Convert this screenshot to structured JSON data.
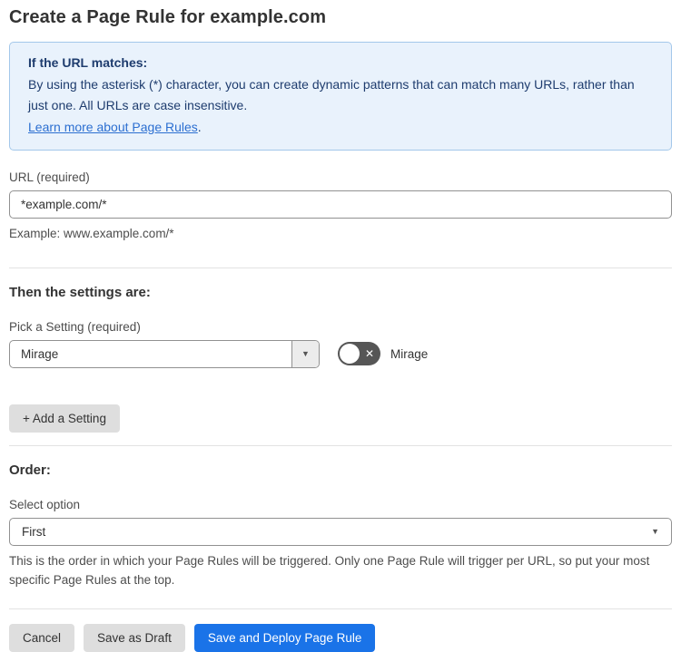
{
  "page": {
    "title": "Create a Page Rule for example.com"
  },
  "info_box": {
    "heading": "If the URL matches:",
    "body": "By using the asterisk (*) character, you can create dynamic patterns that can match many URLs, rather than just one. All URLs are case insensitive.",
    "link_label": "Learn more about Page Rules",
    "link_suffix": "."
  },
  "url_field": {
    "label": "URL (required)",
    "value": "*example.com/*",
    "helper": "Example: www.example.com/*"
  },
  "settings_section": {
    "heading": "Then the settings are:",
    "picker_label": "Pick a Setting (required)",
    "picker_value": "Mirage",
    "toggle_label": "Mirage",
    "toggle_state": "off",
    "add_button_label": "+ Add a Setting"
  },
  "order_section": {
    "heading": "Order:",
    "select_label": "Select option",
    "select_value": "First",
    "helper": "This is the order in which your Page Rules will be triggered. Only one Page Rule will trigger per URL, so put your most specific Page Rules at the top."
  },
  "footer": {
    "cancel_label": "Cancel",
    "save_draft_label": "Save as Draft",
    "save_deploy_label": "Save and Deploy Page Rule"
  },
  "icons": {
    "dropdown_arrow": "▼",
    "toggle_x": "✕"
  },
  "colors": {
    "accent_blue": "#1a73e8",
    "info_bg": "#e9f2fc",
    "info_border": "#a3c7ea",
    "info_text": "#1e3c6e",
    "link_blue": "#2c6fd1",
    "toggle_off_bg": "#565656"
  }
}
